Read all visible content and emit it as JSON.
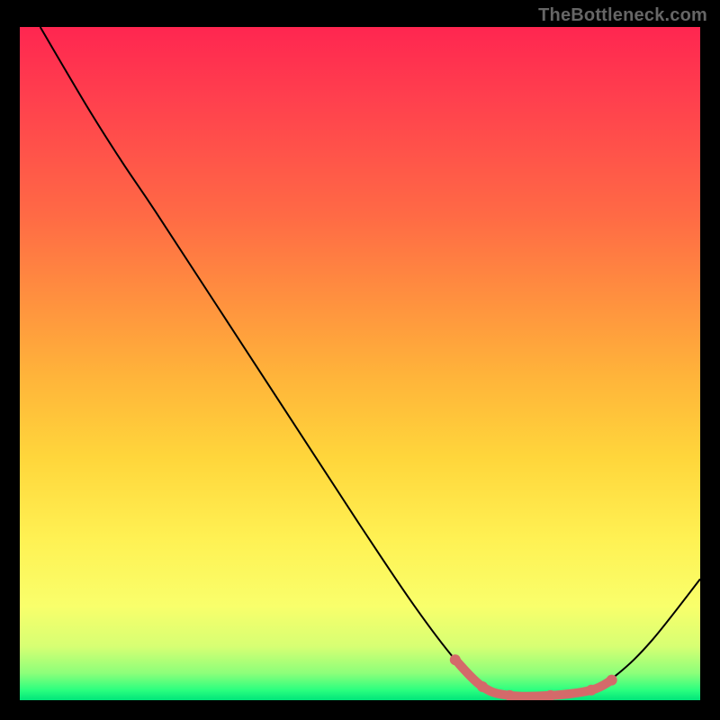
{
  "watermark": "TheBottleneck.com",
  "chart_data": {
    "type": "line",
    "title": "",
    "xlabel": "",
    "ylabel": "",
    "xlim": [
      0,
      100
    ],
    "ylim": [
      0,
      100
    ],
    "grid": false,
    "legend": false,
    "curve_points": [
      {
        "x": 3,
        "y": 100
      },
      {
        "x": 10,
        "y": 88
      },
      {
        "x": 15,
        "y": 80
      },
      {
        "x": 20,
        "y": 72.5
      },
      {
        "x": 30,
        "y": 57
      },
      {
        "x": 40,
        "y": 41.5
      },
      {
        "x": 50,
        "y": 26
      },
      {
        "x": 58,
        "y": 14
      },
      {
        "x": 64,
        "y": 6
      },
      {
        "x": 68,
        "y": 2
      },
      {
        "x": 72,
        "y": 0.5
      },
      {
        "x": 78,
        "y": 0.5
      },
      {
        "x": 84,
        "y": 1.5
      },
      {
        "x": 88,
        "y": 4
      },
      {
        "x": 93,
        "y": 9
      },
      {
        "x": 100,
        "y": 18
      }
    ],
    "highlight_segment": [
      {
        "x": 64,
        "y": 6
      },
      {
        "x": 68,
        "y": 2
      },
      {
        "x": 72,
        "y": 0.7
      },
      {
        "x": 78,
        "y": 0.7
      },
      {
        "x": 84,
        "y": 1.5
      },
      {
        "x": 87,
        "y": 3
      }
    ]
  }
}
